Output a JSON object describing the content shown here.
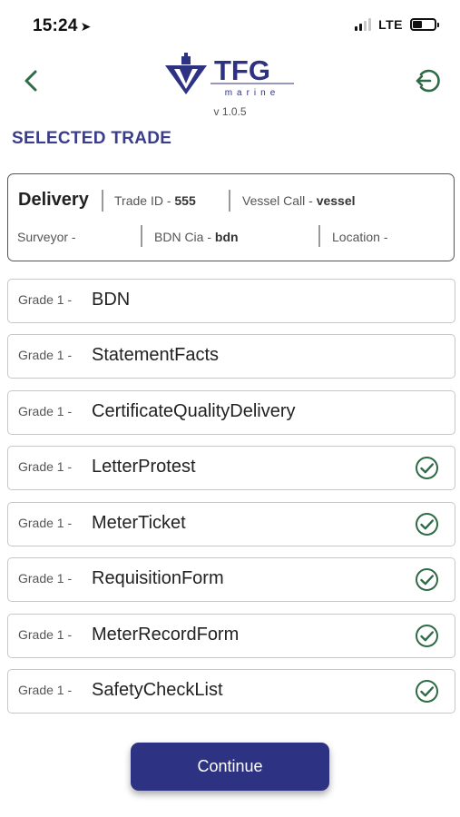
{
  "status_bar": {
    "time": "15:24",
    "location_glyph": "➤",
    "network": "LTE"
  },
  "header": {
    "logo_text": "TFG",
    "logo_subtext": "marine",
    "version": "v 1.0.5"
  },
  "section_title": "SELECTED TRADE",
  "trade": {
    "type": "Delivery",
    "trade_id_label": "Trade ID - ",
    "trade_id": "555",
    "vessel_call_label": "Vessel Call - ",
    "vessel_call": "vessel",
    "surveyor_label": "Surveyor -",
    "bdn_cia_label": "BDN Cia - ",
    "bdn_cia": "bdn",
    "location_label": "Location -"
  },
  "documents": [
    {
      "grade": "Grade 1 -",
      "name": "BDN",
      "checked": false
    },
    {
      "grade": "Grade 1 -",
      "name": "StatementFacts",
      "checked": false
    },
    {
      "grade": "Grade 1 -",
      "name": "CertificateQualityDelivery",
      "checked": false
    },
    {
      "grade": "Grade 1 -",
      "name": "LetterProtest",
      "checked": true
    },
    {
      "grade": "Grade 1 -",
      "name": "MeterTicket",
      "checked": true
    },
    {
      "grade": "Grade 1 -",
      "name": "RequisitionForm",
      "checked": true
    },
    {
      "grade": "Grade 1 -",
      "name": "MeterRecordForm",
      "checked": true
    },
    {
      "grade": "Grade 1 -",
      "name": "SafetyCheckList",
      "checked": true
    }
  ],
  "continue_label": "Continue",
  "icons": {
    "back": "chevron-left-icon",
    "logout": "logout-icon",
    "check": "check-circle-icon"
  },
  "colors": {
    "brand_navy": "#2e3282",
    "title": "#3a3c8c",
    "icon_green": "#2f6b47",
    "check_green": "#2f6b47"
  }
}
